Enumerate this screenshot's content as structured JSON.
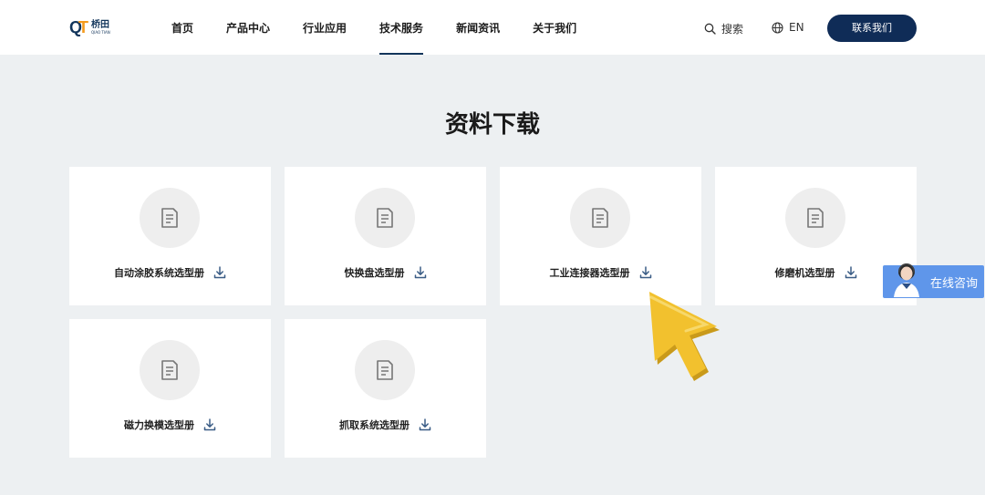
{
  "brand": {
    "mark_q": "Q",
    "mark_t": "T",
    "name_cn": "桥田",
    "name_en": "QIAO TIAN"
  },
  "nav": {
    "items": [
      {
        "label": "首页",
        "active": false
      },
      {
        "label": "产品中心",
        "active": false
      },
      {
        "label": "行业应用",
        "active": false
      },
      {
        "label": "技术服务",
        "active": true
      },
      {
        "label": "新闻资讯",
        "active": false
      },
      {
        "label": "关于我们",
        "active": false
      }
    ]
  },
  "header_tools": {
    "search_label": "搜索",
    "lang_label": "EN",
    "contact_label": "联系我们"
  },
  "page": {
    "title": "资料下载"
  },
  "cards": [
    {
      "label": "自动涂胶系统选型册"
    },
    {
      "label": "快换盘选型册"
    },
    {
      "label": "工业连接器选型册"
    },
    {
      "label": "修磨机选型册"
    },
    {
      "label": "磁力换模选型册"
    },
    {
      "label": "抓取系统选型册"
    }
  ],
  "chat": {
    "label": "在线咨询"
  },
  "colors": {
    "brand_navy": "#0f2c57",
    "brand_orange": "#f39a1e",
    "chat_blue": "#5f96ea",
    "cursor_yellow": "#f2c12e"
  }
}
